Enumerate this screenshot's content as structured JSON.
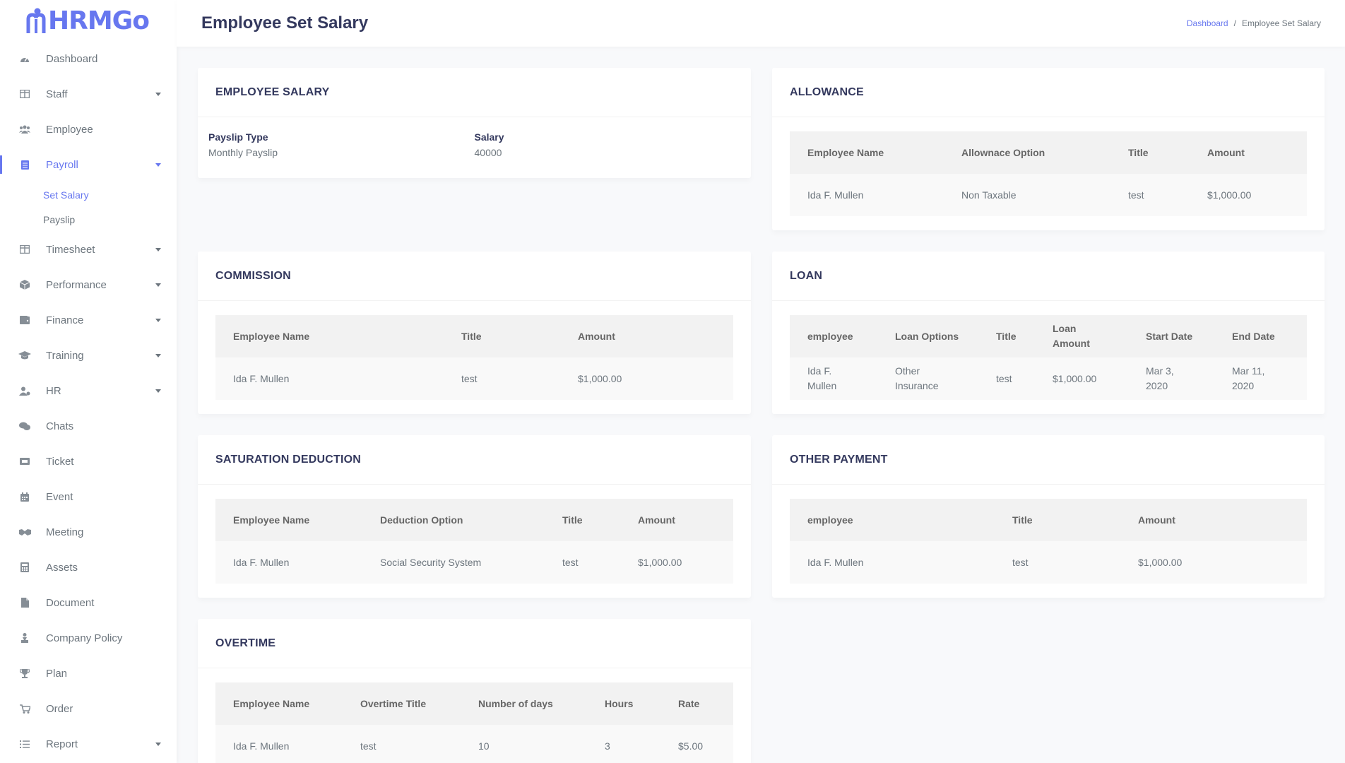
{
  "app": {
    "logo_text": "HRMGo"
  },
  "header": {
    "title": "Employee Set Salary",
    "breadcrumb": {
      "home": "Dashboard",
      "separator": "/",
      "current": "Employee Set Salary"
    }
  },
  "sidebar": {
    "items": [
      {
        "label": "Dashboard",
        "icon": "dashboard-icon"
      },
      {
        "label": "Staff",
        "icon": "staff-icon"
      },
      {
        "label": "Employee",
        "icon": "employee-icon"
      },
      {
        "label": "Payroll",
        "icon": "payroll-icon"
      },
      {
        "label": "Timesheet",
        "icon": "timesheet-icon"
      },
      {
        "label": "Performance",
        "icon": "performance-icon"
      },
      {
        "label": "Finance",
        "icon": "finance-icon"
      },
      {
        "label": "Training",
        "icon": "training-icon"
      },
      {
        "label": "HR",
        "icon": "hr-icon"
      },
      {
        "label": "Chats",
        "icon": "chats-icon"
      },
      {
        "label": "Ticket",
        "icon": "ticket-icon"
      },
      {
        "label": "Event",
        "icon": "event-icon"
      },
      {
        "label": "Meeting",
        "icon": "meeting-icon"
      },
      {
        "label": "Assets",
        "icon": "assets-icon"
      },
      {
        "label": "Document",
        "icon": "document-icon"
      },
      {
        "label": "Company Policy",
        "icon": "policy-icon"
      },
      {
        "label": "Plan",
        "icon": "trophy-icon"
      },
      {
        "label": "Order",
        "icon": "cart-icon"
      },
      {
        "label": "Report",
        "icon": "report-icon"
      }
    ],
    "payroll_sub": [
      "Set Salary",
      "Payslip"
    ]
  },
  "employee_salary": {
    "title": "EMPLOYEE SALARY",
    "payslip_type_label": "Payslip Type",
    "payslip_type_value": "Monthly Payslip",
    "salary_label": "Salary",
    "salary_value": "40000"
  },
  "allowance": {
    "title": "ALLOWANCE",
    "headers": [
      "Employee Name",
      "Allownace Option",
      "Title",
      "Amount"
    ],
    "rows": [
      [
        "Ida F. Mullen",
        "Non Taxable",
        "test",
        "$1,000.00"
      ]
    ]
  },
  "commission": {
    "title": "COMMISSION",
    "headers": [
      "Employee Name",
      "Title",
      "Amount"
    ],
    "rows": [
      [
        "Ida F. Mullen",
        "test",
        "$1,000.00"
      ]
    ]
  },
  "loan": {
    "title": "LOAN",
    "headers": [
      "employee",
      "Loan Options",
      "Title",
      "Loan Amount",
      "Start Date",
      "End Date"
    ],
    "rows": [
      [
        "Ida F. Mullen",
        "Other Insurance",
        "test",
        "$1,000.00",
        "Mar 3, 2020",
        "Mar 11, 2020"
      ]
    ]
  },
  "saturation_deduction": {
    "title": "SATURATION DEDUCTION",
    "headers": [
      "Employee Name",
      "Deduction Option",
      "Title",
      "Amount"
    ],
    "rows": [
      [
        "Ida F. Mullen",
        "Social Security System",
        "test",
        "$1,000.00"
      ]
    ]
  },
  "other_payment": {
    "title": "OTHER PAYMENT",
    "headers": [
      "employee",
      "Title",
      "Amount"
    ],
    "rows": [
      [
        "Ida F. Mullen",
        "test",
        "$1,000.00"
      ]
    ]
  },
  "overtime": {
    "title": "OVERTIME",
    "headers": [
      "Employee Name",
      "Overtime Title",
      "Number of days",
      "Hours",
      "Rate"
    ],
    "rows": [
      [
        "Ida F. Mullen",
        "test",
        "10",
        "3",
        "$5.00"
      ]
    ]
  }
}
